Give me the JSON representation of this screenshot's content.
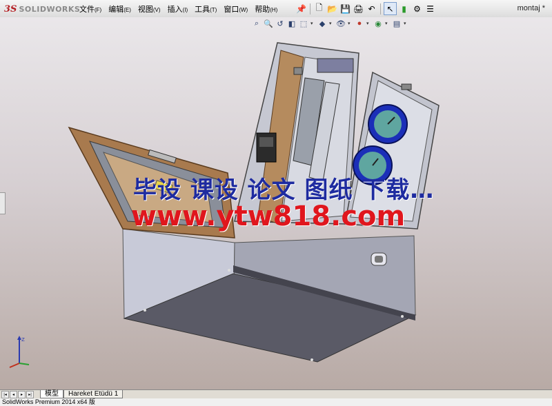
{
  "app": {
    "logo_mark": "3S",
    "logo_text": "SOLIDWORKS",
    "document_name": "montaj *"
  },
  "menu": [
    {
      "label": "文件",
      "acc": "(F)"
    },
    {
      "label": "编辑",
      "acc": "(E)"
    },
    {
      "label": "视图",
      "acc": "(V)"
    },
    {
      "label": "插入",
      "acc": "(I)"
    },
    {
      "label": "工具",
      "acc": "(T)"
    },
    {
      "label": "窗口",
      "acc": "(W)"
    },
    {
      "label": "帮助",
      "acc": "(H)"
    }
  ],
  "toolbar_icons": [
    "pin-icon",
    "new-document-icon",
    "open-icon",
    "save-icon",
    "print-icon",
    "undo-icon",
    "select-icon",
    "traffic-light-icon",
    "options-icon",
    "list-icon"
  ],
  "heads_up_icons": [
    "zoom-to-fit-icon",
    "zoom-area-icon",
    "previous-view-icon",
    "section-view-icon",
    "view-orientation-icon",
    "display-style-icon",
    "hide-show-icon",
    "appearance-icon",
    "scene-icon",
    "view-settings-icon"
  ],
  "watermark": {
    "line1": "毕设 课设 论文 图纸 下载…",
    "line2": "www.ytw818.com"
  },
  "tabs": {
    "active": "模型",
    "second": "Hareket Etüdü 1"
  },
  "status": {
    "text": "SolidWorks Premium 2014 x64 版"
  },
  "colors": {
    "watermark_blue": "#1e2ba0",
    "watermark_red": "#e0161d",
    "brand_red": "#b41e23",
    "door_wood": "#a87a4e",
    "gauge_blue": "#1b2fb8",
    "gauge_face": "#5fa6a0",
    "box_grey": "#9a9ba7"
  }
}
